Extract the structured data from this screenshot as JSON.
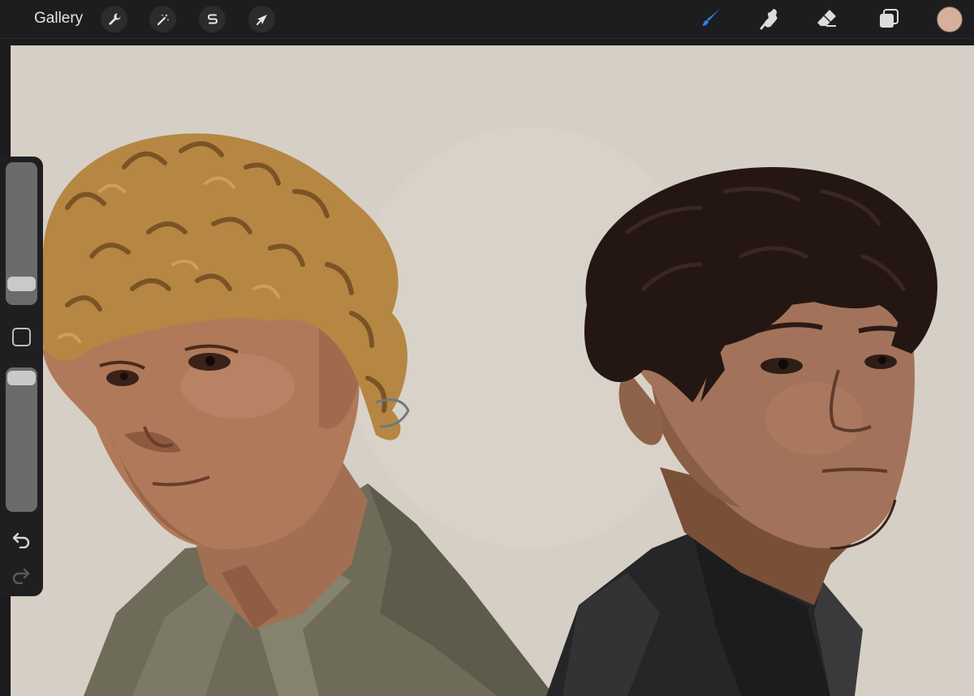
{
  "topbar": {
    "gallery_label": "Gallery",
    "left_tools": [
      {
        "name": "actions",
        "icon": "wrench-icon"
      },
      {
        "name": "adjustments",
        "icon": "magic-wand-icon"
      },
      {
        "name": "selection",
        "icon": "selection-s-icon"
      },
      {
        "name": "transform",
        "icon": "arrow-cursor-icon"
      }
    ],
    "right_tools": [
      {
        "name": "brush",
        "icon": "brush-icon",
        "active": true
      },
      {
        "name": "smudge",
        "icon": "smudge-finger-icon"
      },
      {
        "name": "eraser",
        "icon": "eraser-icon"
      },
      {
        "name": "layers",
        "icon": "layers-icon"
      }
    ],
    "current_color": "#d7b09b"
  },
  "colors": {
    "accent": "#2f7cf6",
    "canvas_bg": "#d6cfc6",
    "toolbar_bg": "#1d1d1f"
  },
  "sidebar": {
    "brush_size_level": 0.12,
    "opacity_level": 0.97,
    "modifier_icon": "square-modifier-icon",
    "undo_icon": "undo-icon",
    "redo_icon": "redo-icon"
  }
}
